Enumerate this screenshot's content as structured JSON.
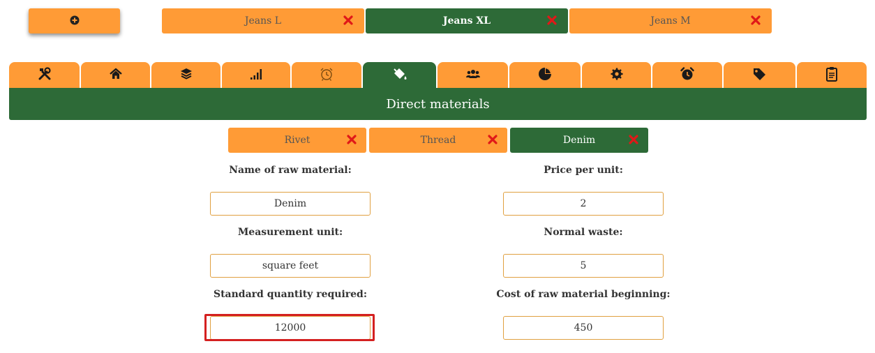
{
  "add_button": {
    "icon": "plus-circle-icon"
  },
  "product_tabs": [
    {
      "label": "Jeans L",
      "active": false
    },
    {
      "label": "Jeans XL",
      "active": true
    },
    {
      "label": "Jeans M",
      "active": false
    }
  ],
  "nav_tabs": [
    {
      "icon": "tools-icon",
      "active": false
    },
    {
      "icon": "home-icon",
      "active": false
    },
    {
      "icon": "layers-icon",
      "active": false
    },
    {
      "icon": "signal-bars-icon",
      "active": false
    },
    {
      "icon": "alarm-clock-outline-icon",
      "active": false
    },
    {
      "icon": "paint-bucket-icon",
      "active": true
    },
    {
      "icon": "users-icon",
      "active": false
    },
    {
      "icon": "pie-chart-icon",
      "active": false
    },
    {
      "icon": "gear-icon",
      "active": false
    },
    {
      "icon": "alarm-clock-icon",
      "active": false
    },
    {
      "icon": "tags-icon",
      "active": false
    },
    {
      "icon": "clipboard-icon",
      "active": false
    }
  ],
  "section_title": "Direct materials",
  "material_tabs": [
    {
      "label": "Rivet",
      "active": false
    },
    {
      "label": "Thread",
      "active": false
    },
    {
      "label": "Denim",
      "active": true
    }
  ],
  "form": {
    "name_label": "Name of raw material:",
    "name_value": "Denim",
    "price_label": "Price per unit:",
    "price_value": "2",
    "unit_label": "Measurement unit:",
    "unit_value": "square feet",
    "waste_label": "Normal waste:",
    "waste_value": "5",
    "qty_label": "Standard quantity required:",
    "qty_value": "12000",
    "cost_label": "Cost of raw material beginning:",
    "cost_value": "450"
  },
  "colors": {
    "orange": "#ff9b36",
    "green": "#2d6a37",
    "close_red": "#e01818",
    "highlight_red": "#d42020"
  }
}
